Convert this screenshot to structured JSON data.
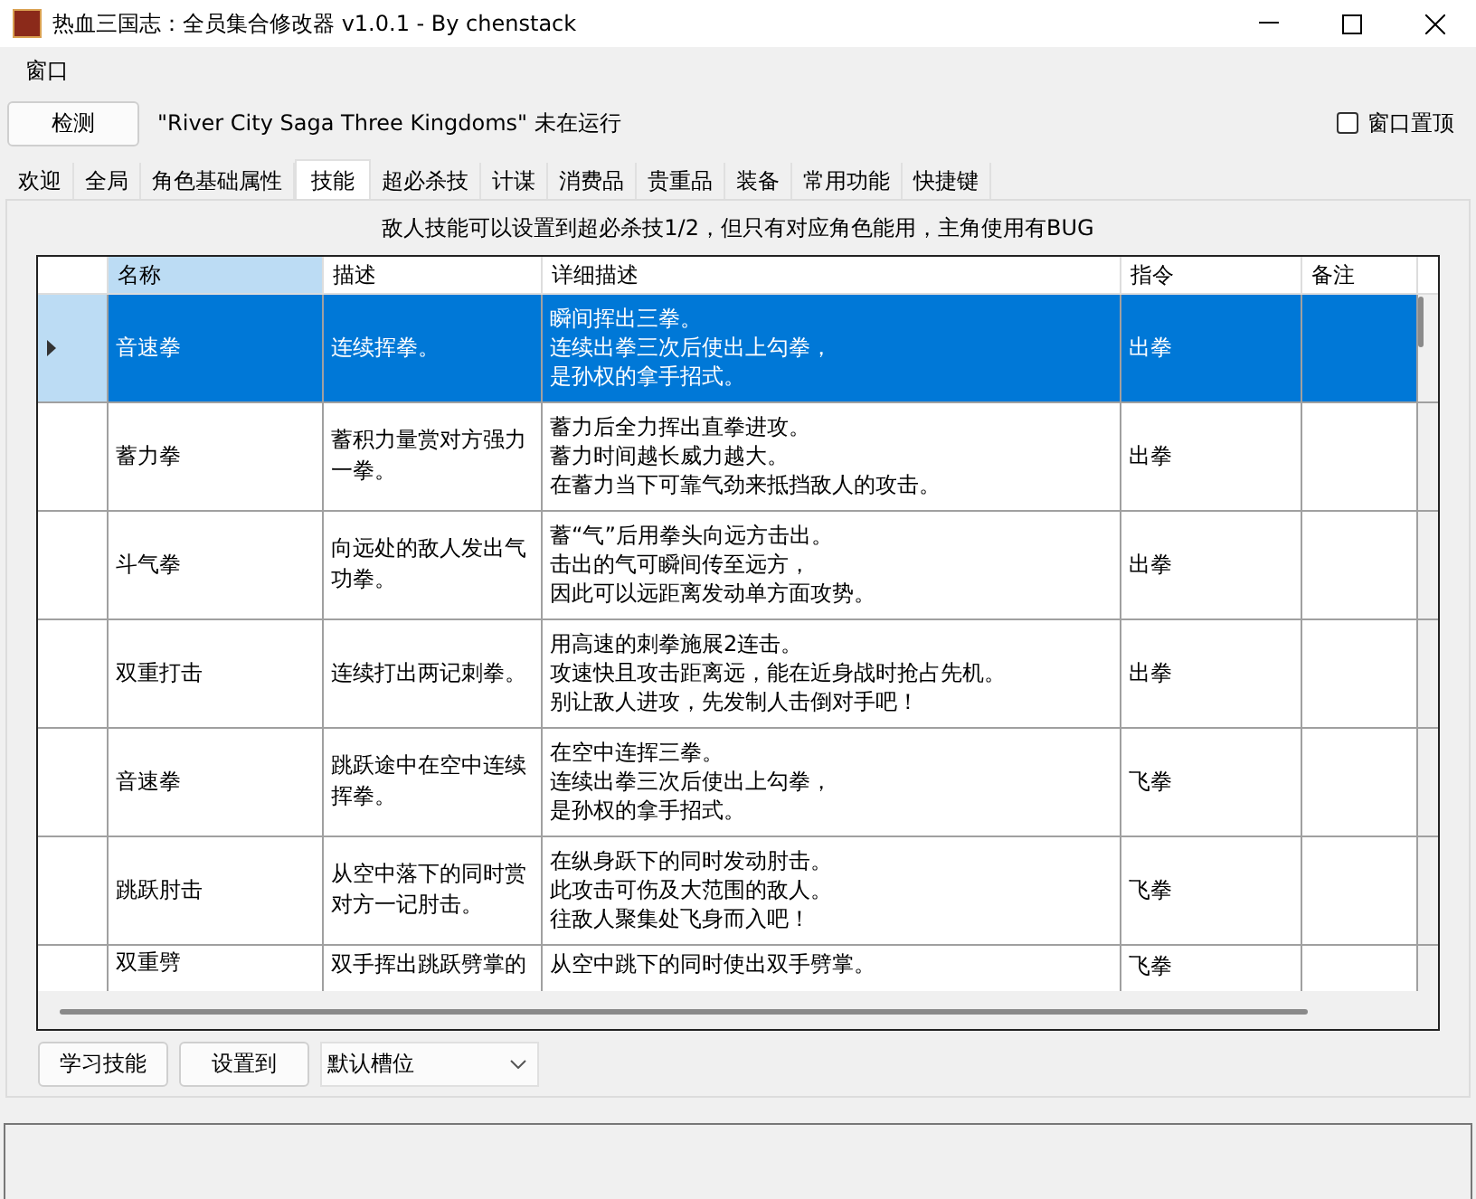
{
  "window": {
    "title": "热血三国志：全员集合修改器 v1.0.1 - By chenstack"
  },
  "menu": [
    "窗口"
  ],
  "toolbar": {
    "detect_button": "检测",
    "status": "\"River City Saga Three Kingdoms\" 未在运行",
    "topmost": {
      "label": "窗口置顶",
      "checked": false
    }
  },
  "tabs": [
    {
      "label": "欢迎",
      "selected": false
    },
    {
      "label": "全局",
      "selected": false
    },
    {
      "label": "角色基础属性",
      "selected": false
    },
    {
      "label": "技能",
      "selected": true
    },
    {
      "label": "超必杀技",
      "selected": false
    },
    {
      "label": "计谋",
      "selected": false
    },
    {
      "label": "消费品",
      "selected": false
    },
    {
      "label": "贵重品",
      "selected": false
    },
    {
      "label": "装备",
      "selected": false
    },
    {
      "label": "常用功能",
      "selected": false
    },
    {
      "label": "快捷键",
      "selected": false
    }
  ],
  "notice": "敌人技能可以设置到超必杀技1/2，但只有对应角色能用，主角使用有BUG",
  "table": {
    "columns": [
      "名称",
      "描述",
      "详细描述",
      "指令",
      "备注"
    ],
    "rows": [
      {
        "selected": true,
        "name": "音速拳",
        "desc": "连续挥拳。",
        "detail": [
          "瞬间挥出三拳。",
          "连续出拳三次后使出上勾拳，",
          "是孙权的拿手招式。"
        ],
        "command": "出拳"
      },
      {
        "selected": false,
        "name": "蓄力拳",
        "desc": "蓄积力量赏对方强力一拳。",
        "detail": [
          "蓄力后全力挥出直拳进攻。",
          "蓄力时间越长威力越大。",
          "在蓄力当下可靠气劲来抵挡敌人的攻击。"
        ],
        "command": "出拳"
      },
      {
        "selected": false,
        "name": "斗气拳",
        "desc": "向远处的敌人发出气功拳。",
        "detail": [
          "蓄“气”后用拳头向远方击出。",
          "击出的气可瞬间传至远方，",
          "因此可以远距离发动单方面攻势。"
        ],
        "command": "出拳"
      },
      {
        "selected": false,
        "name": "双重打击",
        "desc": "连续打出两记刺拳。",
        "detail": [
          "用高速的刺拳施展2连击。",
          "攻速快且攻击距离远，能在近身战时抢占先机。",
          "别让敌人进攻，先发制人击倒对手吧！"
        ],
        "command": "出拳"
      },
      {
        "selected": false,
        "name": "音速拳",
        "desc": "跳跃途中在空中连续挥拳。",
        "detail": [
          "在空中连挥三拳。",
          "连续出拳三次后使出上勾拳，",
          "是孙权的拿手招式。"
        ],
        "command": "飞拳"
      },
      {
        "selected": false,
        "name": "跳跃肘击",
        "desc": "从空中落下的同时赏对方一记肘击。",
        "detail": [
          "在纵身跃下的同时发动肘击。",
          "此攻击可伤及大范围的敌人。",
          "往敌人聚集处飞身而入吧！"
        ],
        "command": "飞拳"
      },
      {
        "selected": false,
        "name": "双重劈",
        "desc": "双手挥出跳跃劈掌的",
        "detail": [
          "从空中跳下的同时使出双手劈掌。"
        ],
        "command": "飞拳"
      }
    ]
  },
  "bottom": {
    "learn_button": "学习技能",
    "set_button": "设置到",
    "slot_select": "默认槽位"
  }
}
